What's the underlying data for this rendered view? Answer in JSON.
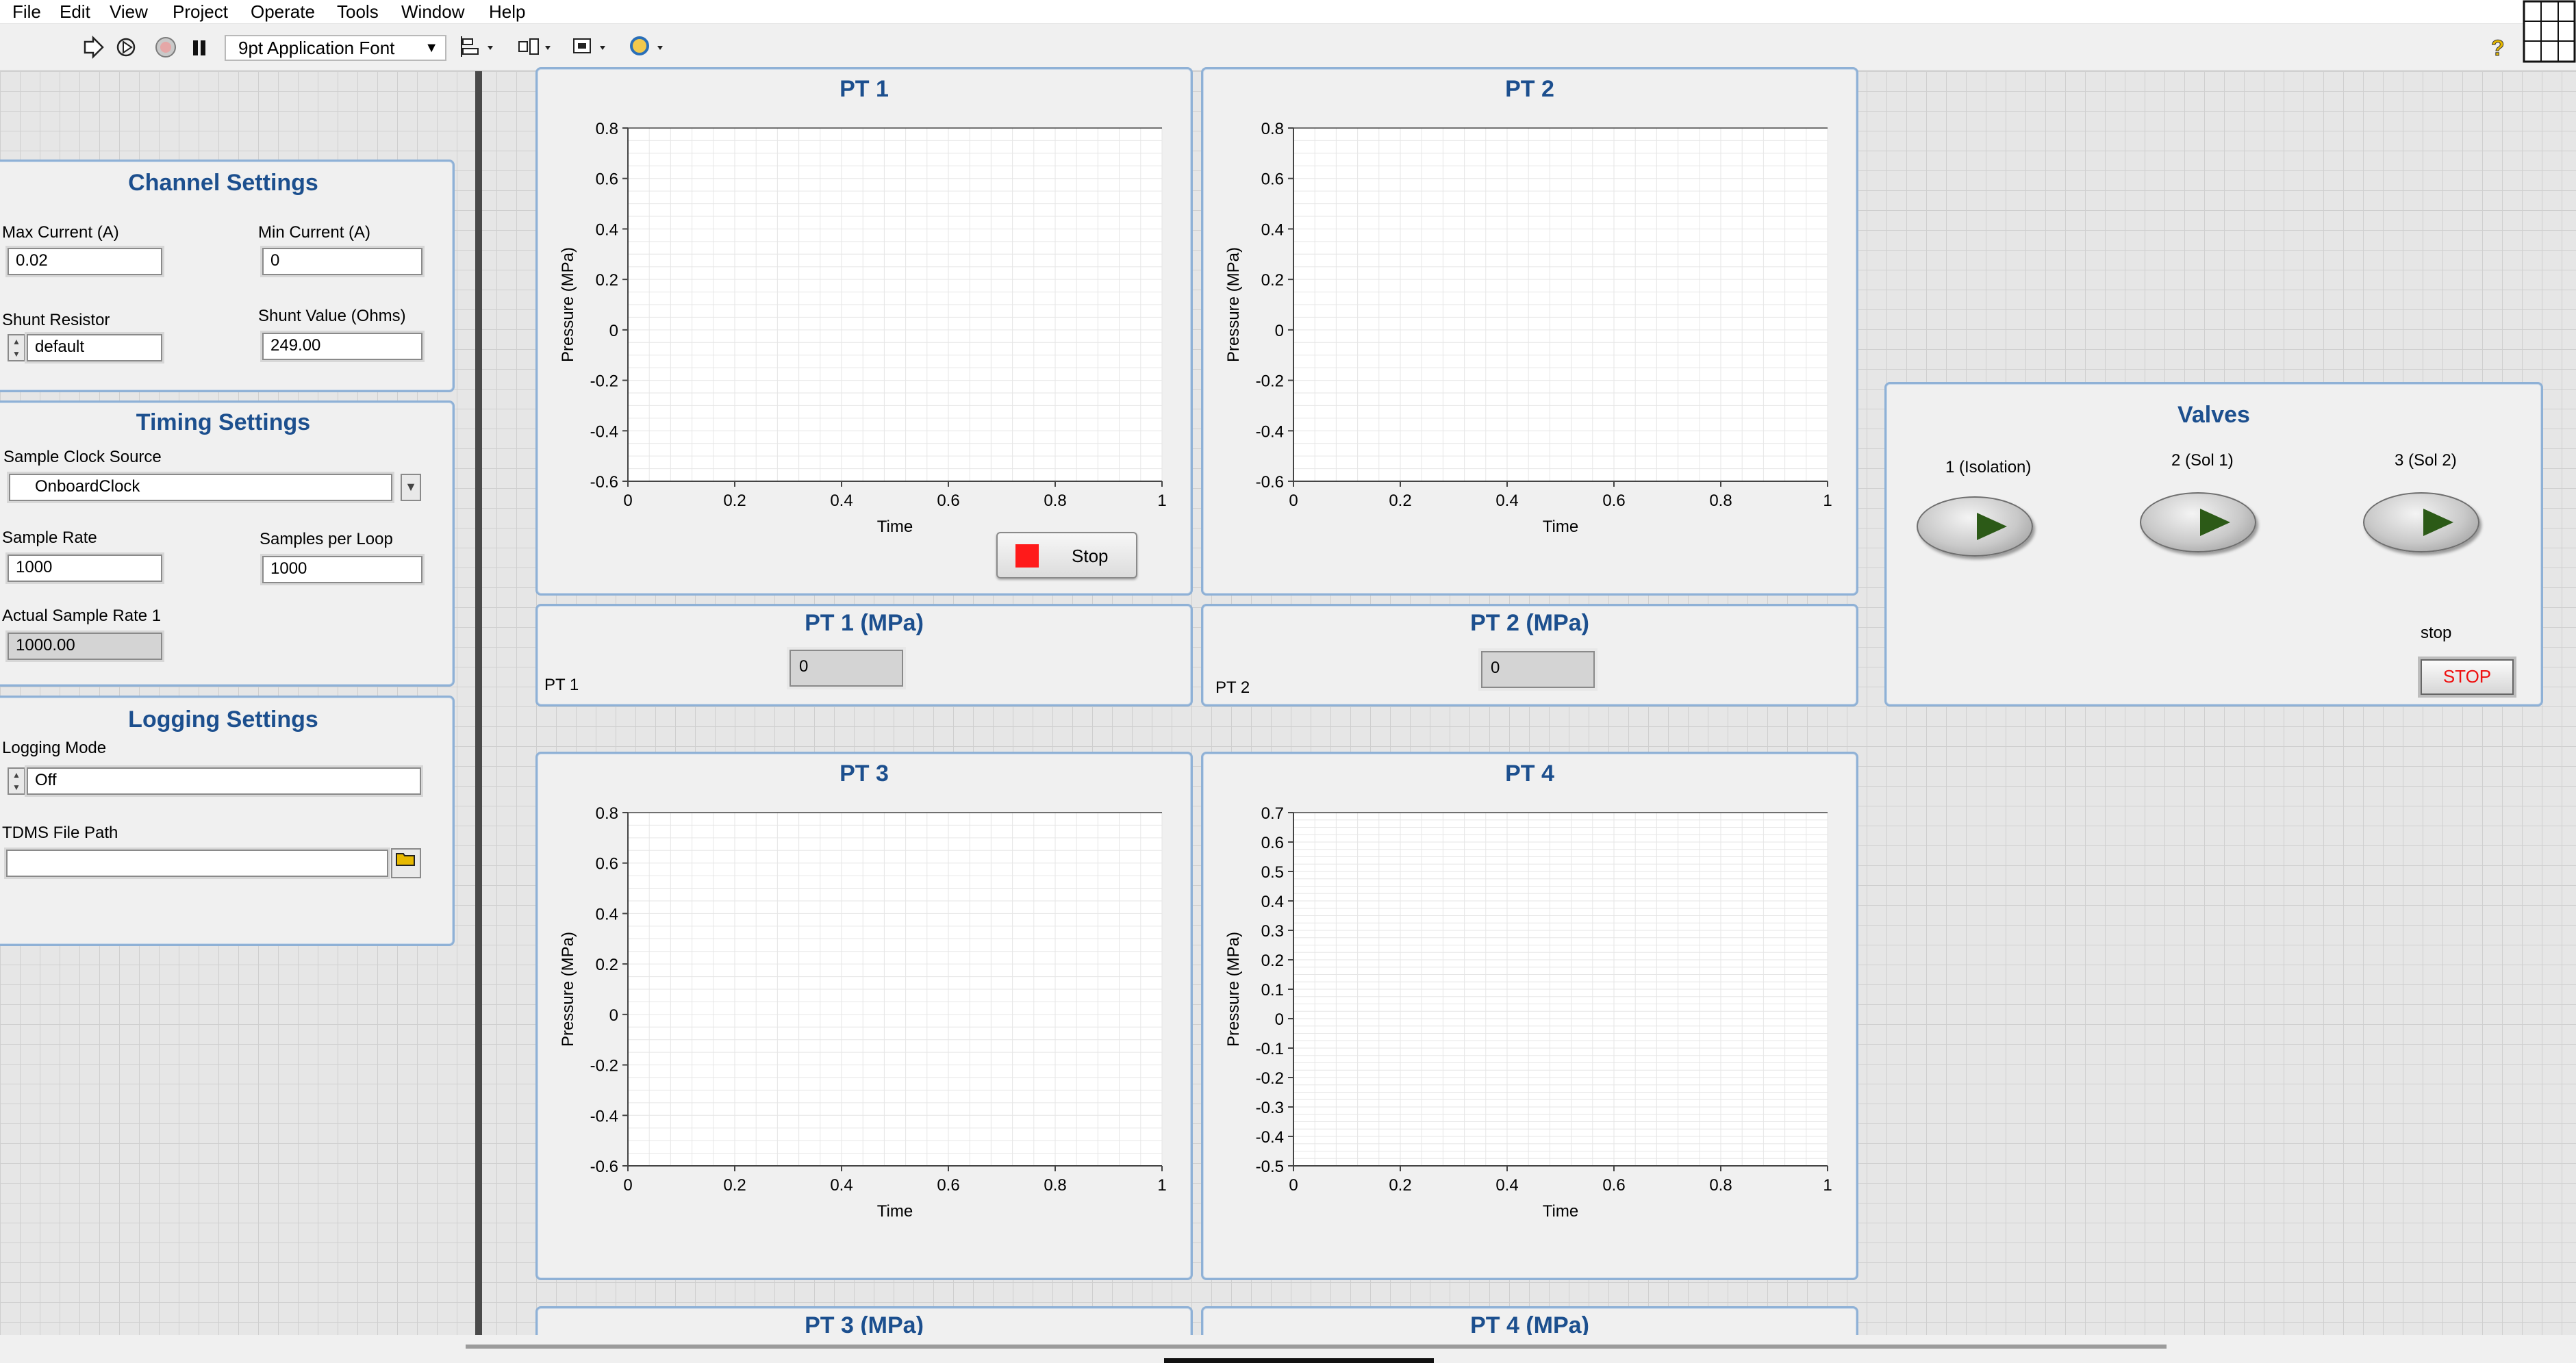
{
  "menu": [
    "File",
    "Edit",
    "View",
    "Project",
    "Operate",
    "Tools",
    "Window",
    "Help"
  ],
  "toolbar": {
    "font_label": "9pt Application Font",
    "help_icon": "question-mark-icon"
  },
  "channel_settings": {
    "title": "Channel Settings",
    "max_current_label": "Max Current (A)",
    "max_current_value": "0.02",
    "min_current_label": "Min Current (A)",
    "min_current_value": "0",
    "shunt_resistor_label": "Shunt Resistor",
    "shunt_resistor_value": "default",
    "shunt_value_label": "Shunt Value (Ohms)",
    "shunt_value_value": "249.00"
  },
  "timing_settings": {
    "title": "Timing Settings",
    "sample_clock_label": "Sample Clock Source",
    "sample_clock_value": "OnboardClock",
    "sample_rate_label": "Sample Rate",
    "sample_rate_value": "1000",
    "samples_per_loop_label": "Samples per Loop",
    "samples_per_loop_value": "1000",
    "actual_rate_label": "Actual Sample Rate 1",
    "actual_rate_value": "1000.00"
  },
  "logging_settings": {
    "title": "Logging Settings",
    "mode_label": "Logging Mode",
    "mode_value": "Off",
    "path_label": "TDMS File Path",
    "path_value": ""
  },
  "graphs": [
    {
      "title": "PT 1",
      "xlabel": "Time",
      "ylabel": "Pressure (MPa)"
    },
    {
      "title": "PT 2",
      "xlabel": "Time",
      "ylabel": "Pressure (MPa)"
    },
    {
      "title": "PT 3",
      "xlabel": "Time",
      "ylabel": "Pressure (MPa)"
    },
    {
      "title": "PT 4",
      "xlabel": "Time",
      "ylabel": "Pressure (MPa)"
    }
  ],
  "chart_data": [
    {
      "type": "line",
      "title": "PT 1",
      "xlabel": "Time",
      "ylabel": "Pressure (MPa)",
      "xlim": [
        0,
        1
      ],
      "ylim": [
        -0.6,
        0.8
      ],
      "grid": true,
      "x_ticks": [
        "0",
        "0.2",
        "0.4",
        "0.6",
        "0.8",
        "1"
      ],
      "y_ticks": [
        "0.8",
        "0.6",
        "0.4",
        "0.2",
        "0",
        "-0.2",
        "-0.4",
        "-0.6"
      ],
      "series": []
    },
    {
      "type": "line",
      "title": "PT 2",
      "xlabel": "Time",
      "ylabel": "Pressure (MPa)",
      "xlim": [
        0,
        1
      ],
      "ylim": [
        -0.6,
        0.8
      ],
      "grid": true,
      "x_ticks": [
        "0",
        "0.2",
        "0.4",
        "0.6",
        "0.8",
        "1"
      ],
      "y_ticks": [
        "0.8",
        "0.6",
        "0.4",
        "0.2",
        "0",
        "-0.2",
        "-0.4",
        "-0.6"
      ],
      "series": []
    },
    {
      "type": "line",
      "title": "PT 3",
      "xlabel": "Time",
      "ylabel": "Pressure (MPa)",
      "xlim": [
        0,
        1
      ],
      "ylim": [
        -0.6,
        0.8
      ],
      "grid": true,
      "x_ticks": [
        "0",
        "0.2",
        "0.4",
        "0.6",
        "0.8",
        "1"
      ],
      "y_ticks": [
        "0.8",
        "0.6",
        "0.4",
        "0.2",
        "0",
        "-0.2",
        "-0.4",
        "-0.6"
      ],
      "series": []
    },
    {
      "type": "line",
      "title": "PT 4",
      "xlabel": "Time",
      "ylabel": "Pressure (MPa)",
      "xlim": [
        0,
        1
      ],
      "ylim": [
        -0.5,
        0.7
      ],
      "grid": true,
      "x_ticks": [
        "0",
        "0.2",
        "0.4",
        "0.6",
        "0.8",
        "1"
      ],
      "y_ticks": [
        "0.7",
        "0.6",
        "0.5",
        "0.4",
        "0.3",
        "0.2",
        "0.1",
        "0",
        "-0.1",
        "-0.2",
        "-0.3",
        "-0.4",
        "-0.5"
      ],
      "series": []
    }
  ],
  "stop_button_label": "Stop",
  "indicators": [
    {
      "title": "PT 1  (MPa)",
      "value": "0",
      "label": "PT 1"
    },
    {
      "title": "PT 2 (MPa)",
      "value": "0",
      "label": "PT 2"
    },
    {
      "title": "PT 3  (MPa)"
    },
    {
      "title": "PT 4  (MPa)"
    }
  ],
  "valves": {
    "title": "Valves",
    "items": [
      {
        "label": "1 (Isolation)"
      },
      {
        "label": "2 (Sol 1)"
      },
      {
        "label": "3 (Sol 2)"
      }
    ],
    "stop_label": "stop",
    "stop_button": "STOP"
  },
  "colors": {
    "panel_title": "#1c4f8e",
    "panel_border": "#8fb1d6",
    "stop_red": "#ff1a1a",
    "valve_led": "#2c5a17",
    "plot_grid": "#e6e6e6"
  }
}
